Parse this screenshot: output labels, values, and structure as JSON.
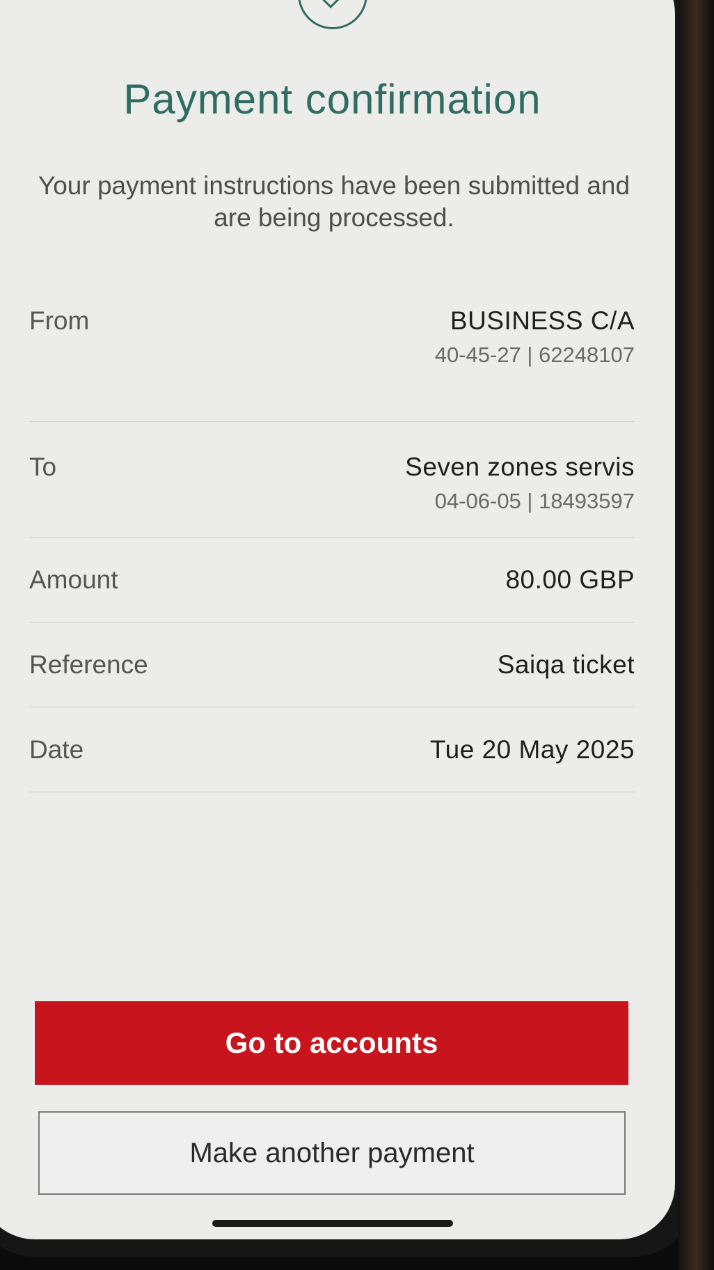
{
  "header": {
    "title": "Payment confirmation",
    "message": "Your payment instructions have been submitted and are being processed."
  },
  "icons": {
    "status": "check-circle-icon"
  },
  "details": {
    "from": {
      "label": "From",
      "value": "BUSINESS C/A",
      "sub": "40-45-27 | 62248107"
    },
    "to": {
      "label": "To",
      "value": "Seven zones servis",
      "sub": "04-06-05 | 18493597"
    },
    "amount": {
      "label": "Amount",
      "value": "80.00 GBP"
    },
    "reference": {
      "label": "Reference",
      "value": "Saiqa ticket"
    },
    "date": {
      "label": "Date",
      "value": "Tue 20 May 2025"
    }
  },
  "actions": {
    "primary": "Go to accounts",
    "secondary": "Make another payment"
  },
  "colors": {
    "accent": "#2f6d62",
    "primary_button": "#c8141c"
  }
}
